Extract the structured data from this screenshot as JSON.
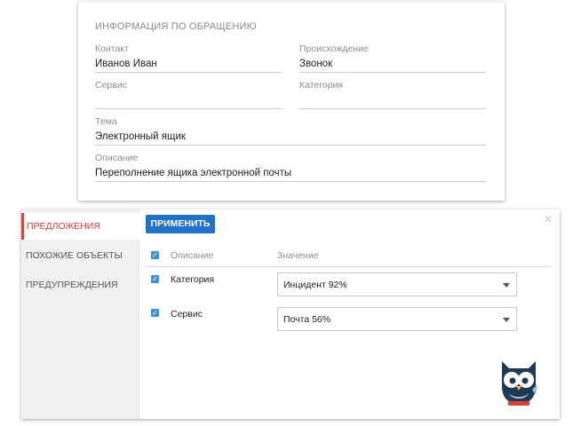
{
  "request_info": {
    "title": "ИНФОРМАЦИЯ ПО ОБРАЩЕНИЮ",
    "fields": {
      "contact": {
        "label": "Контакт",
        "value": "Иванов Иван"
      },
      "origin": {
        "label": "Происхождение",
        "value": "Звонок"
      },
      "service": {
        "label": "Сервис",
        "value": ""
      },
      "category": {
        "label": "Категория",
        "value": ""
      },
      "topic": {
        "label": "Тема",
        "value": "Электронный ящик"
      },
      "description": {
        "label": "Описание",
        "value": "Переполнение ящика электронной почты"
      }
    }
  },
  "suggestions_panel": {
    "sidebar": {
      "items": [
        {
          "label": "ПРЕДЛОЖЕНИЯ",
          "active": true
        },
        {
          "label": "ПОХОЖИЕ ОБЪЕКТЫ",
          "active": false
        },
        {
          "label": "ПРЕДУПРЕЖДЕНИЯ",
          "active": false
        }
      ]
    },
    "apply_label": "ПРИМЕНИТЬ",
    "close_glyph": "×",
    "table": {
      "headers": {
        "description": "Описание",
        "value": "Значение"
      },
      "rows": [
        {
          "label": "Категория",
          "value": "Инцидент 92%",
          "checked": true
        },
        {
          "label": "Сервис",
          "value": "Почта 56%",
          "checked": true
        }
      ]
    },
    "mascot_icon": "owl-mascot-icon"
  },
  "colors": {
    "accent_blue": "#2170c9",
    "active_red": "#d9413a",
    "checkbox_blue": "#3e92d8"
  }
}
